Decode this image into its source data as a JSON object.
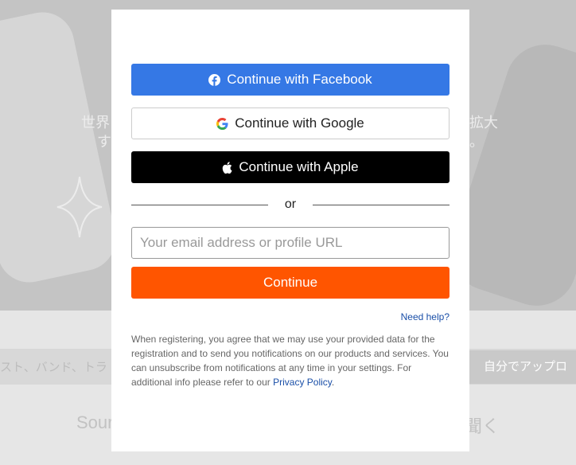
{
  "background": {
    "hero_text_left_1": "世界",
    "hero_text_left_2": "す",
    "hero_text_right_1": "拡大",
    "hero_text_right_2": "。",
    "strip_text_left": "スト、バンド、トラ",
    "upload_button": "自分でアップロ",
    "band_text_left": "Sour",
    "band_text_right": "聞く"
  },
  "modal": {
    "facebook": {
      "label": "Continue with Facebook",
      "icon": "facebook-icon",
      "color": "#3578e5"
    },
    "google": {
      "label": "Continue with Google",
      "icon": "google-g-icon"
    },
    "apple": {
      "label": "Continue with Apple",
      "icon": "apple-icon"
    },
    "divider": {
      "label": "or"
    },
    "email": {
      "value": "",
      "placeholder": "Your email address or profile URL"
    },
    "continue": {
      "label": "Continue",
      "color": "#ff5500"
    },
    "need_help": "Need help?",
    "legal": {
      "text": "When registering, you agree that we may use your provided data for the registration and to send you notifications on our products and services. You can unsubscribe from notifications at any time in your settings. For additional info please refer to our ",
      "link": "Privacy Policy",
      "end": "."
    }
  }
}
